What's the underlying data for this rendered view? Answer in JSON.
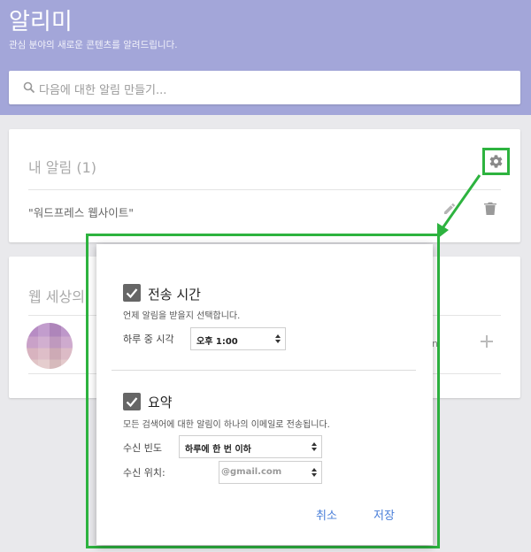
{
  "header": {
    "title": "알리미",
    "subtitle": "관심 분야의 새로운 콘텐츠를 알려드립니다."
  },
  "search": {
    "placeholder": "다음에 대한 알림 만들기...",
    "icon": "search-icon"
  },
  "my_alerts": {
    "title": "내 알림",
    "count": "(1)",
    "items": [
      {
        "label": "\"워드프레스 웹사이트\""
      }
    ],
    "settings_icon": "gear-icon",
    "edit_icon": "pencil-icon",
    "delete_icon": "trash-icon"
  },
  "web_section": {
    "title": "웹 세상의",
    "item_text_left": "",
    "item_text_right": "n",
    "add_icon": "plus-icon"
  },
  "dialog": {
    "delivery": {
      "checked": true,
      "label": "전송 시간",
      "description": "언제 알림을 받을지 선택합니다.",
      "time_label": "하루 중 시각",
      "time_value": "오후 1:00"
    },
    "digest": {
      "checked": true,
      "label": "요약",
      "description": "모든 검색어에 대한 알림이 하나의 이메일로 전송됩니다.",
      "frequency_label": "수신 빈도",
      "frequency_value": "하루에 한 번 이하",
      "delivery_to_label": "수신 위치:",
      "delivery_to_value": "@gmail.com"
    },
    "cancel_label": "취소",
    "save_label": "저장"
  },
  "colors": {
    "header_bg": "#a3a6d9",
    "highlight_green": "#2db33f",
    "button_blue": "#4a7fd9",
    "checkbox_gray": "#666666"
  }
}
